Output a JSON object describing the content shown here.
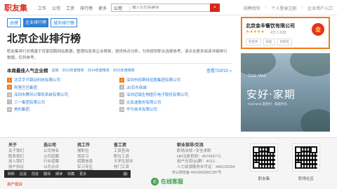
{
  "header": {
    "logo": "职友集",
    "nav": [
      "工作",
      "公司",
      "工资",
      "排行榜",
      "更多"
    ],
    "search": {
      "type": "公司",
      "placeholder": "输入公司关键词",
      "button": "⌕"
    },
    "links": [
      "招聘找你",
      "个人登录注册",
      "企业用户入口"
    ]
  },
  "breadcrumb": [
    "总榜",
    "企业排行榜",
    "城市排行榜"
  ],
  "page": {
    "title": "北京企业排行榜",
    "description": "职友集排行总榜基于百家招聘网站数据，整理出各类企业榜单，提供热点分析，为你提供职业选择参考，请点击更多阅读详细排行数据，仅供参考。"
  },
  "company_card": {
    "name": "北京金丰餐饮有限公司",
    "stars": "★★★★★",
    "rating": "4万人浏览",
    "tags": [
      "在招中",
      "知名",
      "有职位"
    ],
    "logo_text": "金"
  },
  "ad": {
    "brand": "Club Med",
    "slogan": "安好·家期",
    "sub": "Club Med 度假村 · 家庭时光"
  },
  "popular": {
    "title": "本周最佳人气企业榜",
    "tabs": [
      "总榜",
      "2013年度榜单",
      "2014年度榜单",
      "2015年度榜单"
    ],
    "more": "查看TOP20 »",
    "items": [
      {
        "rank": "1",
        "name": "北京字节跳动科技有限公司"
      },
      {
        "rank": "2",
        "name": "深圳市拓斯特控股集团有限公司"
      },
      {
        "rank": "3",
        "name": "阿里巴巴集团"
      },
      {
        "rank": "4",
        "name": "JD京东商城"
      },
      {
        "rank": "5",
        "name": "深圳市腾讯计算机系统有限公司"
      },
      {
        "rank": "6",
        "name": "深圳迈瑞生物医疗电子股份有限公司"
      },
      {
        "rank": "7",
        "name": "三一集团有限公司"
      },
      {
        "rank": "8",
        "name": "比亚迪股份有限公司"
      },
      {
        "rank": "9",
        "name": "美的集团"
      },
      {
        "rank": "10",
        "name": "华为技术有限公司"
      }
    ]
  },
  "footer": {
    "cols": [
      {
        "head": "关于",
        "links": [
          "关于我们",
          "联系我们",
          "加入我们",
          "用户协议",
          "隐私政策"
        ]
      },
      {
        "head": "选公司",
        "links": [
          "公司排名",
          "公司招聘",
          "行业招聘",
          "公司点评",
          "公司工资"
        ]
      },
      {
        "head": "找工作",
        "links": [
          "搜职位",
          "找实习",
          "招聘信息",
          "实习专区",
          "校园招聘"
        ]
      },
      {
        "head": "查工资",
        "links": [
          "工资查询",
          "职位工资",
          "大学生就业",
          "热门工资"
        ]
      },
      {
        "head": "职业指导/交流",
        "links": [
          "职场法规 / 安全求职",
          "HR注册官网：457455771",
          "用户交流QQ群：4012..",
          "人力资源服务许可证：440120034"
        ]
      }
    ],
    "police": "粤公网安备 44010602001287号",
    "qr": [
      "职友集",
      "职场社区"
    ],
    "report": "用户投诉",
    "service": "在线客服",
    "toolbar": [
      "刷新",
      "后退",
      "前进",
      "翻译",
      "朗读",
      "收藏",
      "更多"
    ],
    "toolbar_icon": "⏻"
  },
  "colors": {
    "brand": "#d9261c",
    "link": "#2d7fd3",
    "highlight": "#f07a1a"
  }
}
